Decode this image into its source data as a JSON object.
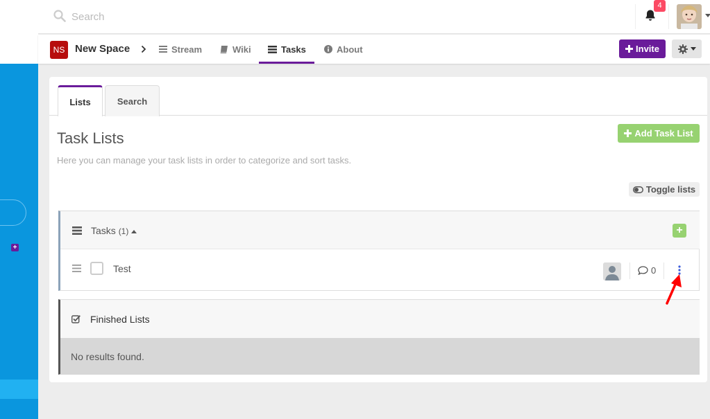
{
  "topbar": {
    "search_placeholder": "Search",
    "notification_count": "4"
  },
  "space": {
    "badge": "NS",
    "name": "New Space",
    "nav": [
      {
        "label": "Stream",
        "icon": "bars-icon"
      },
      {
        "label": "Wiki",
        "icon": "book-icon"
      },
      {
        "label": "Tasks",
        "icon": "tasks-icon"
      },
      {
        "label": "About",
        "icon": "info-icon"
      }
    ],
    "invite_label": "Invite"
  },
  "tabs": [
    "Lists",
    "Search"
  ],
  "main": {
    "title": "Task Lists",
    "description": "Here you can manage your task lists in order to categorize and sort tasks.",
    "add_list_label": "Add Task List",
    "toggle_label": "Toggle lists"
  },
  "task_list": {
    "title": "Tasks",
    "count": "(1)",
    "tasks": [
      {
        "label": "Test",
        "comments": "0"
      }
    ]
  },
  "finished": {
    "title": "Finished Lists",
    "empty_text": "No results found."
  },
  "colors": {
    "accent": "#6a1b9a",
    "success": "#97d271",
    "sidebar": "#0a96de",
    "badge": "#fc4a64"
  }
}
